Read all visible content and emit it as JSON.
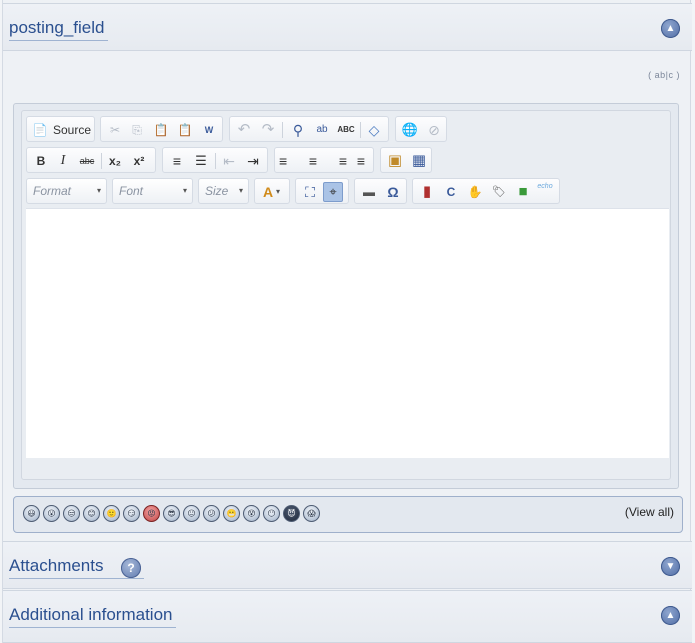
{
  "sections": {
    "posting": {
      "title": "posting_field",
      "toggle": "▲"
    },
    "attachments": {
      "title": "Attachments",
      "help": "?",
      "toggle": "▼"
    },
    "additional": {
      "title": "Additional information",
      "toggle": "▲"
    }
  },
  "spellcheck_hint": "( ab|c )",
  "editor": {
    "toolbar": {
      "source_label": "Source",
      "format_label": "Format",
      "font_label": "Font",
      "size_label": "Size",
      "dropdown_arrow": "▾",
      "icons": {
        "source": "📄",
        "cut": "✂",
        "copy": "⎘",
        "paste": "📋",
        "paste_text": "📋",
        "paste_word": "W",
        "undo": "↶",
        "redo": "↷",
        "find": "⚲",
        "replace": "ab",
        "spellcheck": "ABC",
        "remove_format": "◇",
        "link": "🌐",
        "unlink": "⊘",
        "bold": "B",
        "italic": "I",
        "strike": "abc",
        "subscript": "x₂",
        "superscript": "x²",
        "ordered_list": "≡",
        "unordered_list": "☰",
        "outdent": "⇤",
        "indent": "⇥",
        "align_left": "≡",
        "align_center": "≡",
        "align_right": "≡",
        "justify": "≡",
        "image": "▣",
        "table": "▦",
        "text_color": "A",
        "maximize": "⛶",
        "show_blocks": "⌖",
        "horizontal_rule": "▬",
        "special_char": "Ω",
        "flash": "▮",
        "smiley_c": "C",
        "hand": "✋",
        "tag": "🏷",
        "green": "■",
        "echo": "echo"
      }
    }
  },
  "smilies": {
    "faces": [
      "😃",
      "😮",
      "😒",
      "😊",
      "🙂",
      "😏",
      "😡",
      "😎",
      "😐",
      "😕",
      "😬",
      "😵",
      "😶",
      "😈",
      "😱"
    ],
    "view_all": "(View all)"
  },
  "colors": {
    "accent": "#2a4f8f",
    "panel": "#e4e9f0"
  }
}
